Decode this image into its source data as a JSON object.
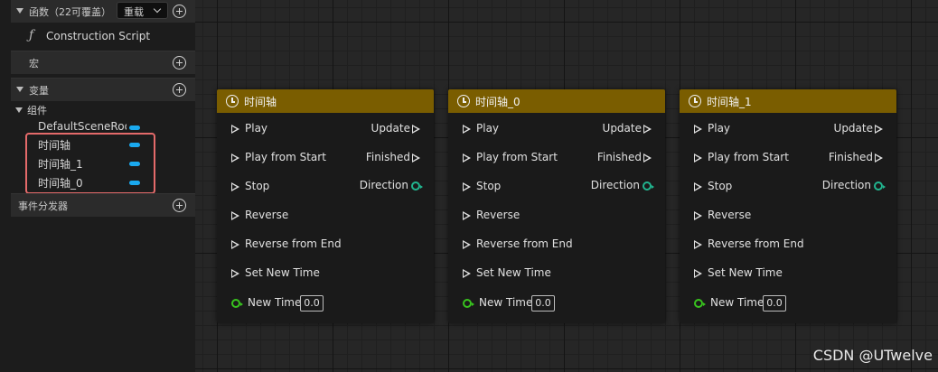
{
  "sidebar": {
    "functions": {
      "label": "函数（22可覆盖）",
      "override_label": "重载",
      "items": [
        "Construction Script"
      ]
    },
    "macros": {
      "label": "宏"
    },
    "variables": {
      "label": "变量"
    },
    "components": {
      "label": "组件",
      "items": [
        "DefaultSceneRoot",
        "时间轴",
        "时间轴_1",
        "时间轴_0"
      ]
    },
    "dispatchers": {
      "label": "事件分发器"
    }
  },
  "nodes": [
    {
      "title": "时间轴"
    },
    {
      "title": "时间轴_0"
    },
    {
      "title": "时间轴_1"
    }
  ],
  "pins": {
    "play": "Play",
    "play_from_start": "Play from Start",
    "stop": "Stop",
    "reverse": "Reverse",
    "reverse_from_end": "Reverse from End",
    "set_new_time": "Set New Time",
    "new_time": "New Time",
    "new_time_value": "0.0",
    "update": "Update",
    "finished": "Finished",
    "direction": "Direction"
  },
  "watermark": "CSDN @UTwelve",
  "colors": {
    "timeline_header": "#7a5d00",
    "component_pill": "#1aa9ef",
    "float_pin": "#38c31e",
    "highlight_box": "#e46a6a"
  }
}
